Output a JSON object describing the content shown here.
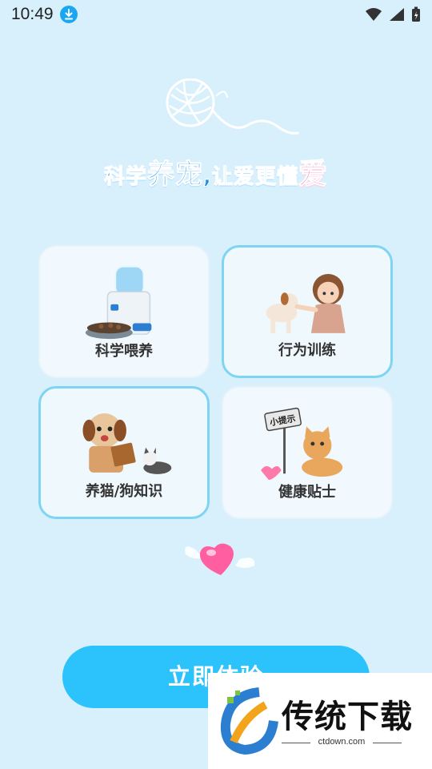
{
  "status_bar": {
    "time": "10:49",
    "icons": [
      "download-icon",
      "wifi-icon",
      "signal-icon",
      "battery-charging-icon"
    ]
  },
  "slogan": {
    "part1": "科学",
    "part2": "养宠",
    "part3": ",让爱更懂",
    "part4": "爱"
  },
  "features": [
    {
      "label": "科学喂养",
      "icon": "water-dispenser-food-bowl-illustration",
      "selected": false
    },
    {
      "label": "行为训练",
      "icon": "girl-training-dog-illustration",
      "selected": true
    },
    {
      "label": "养猫/狗知识",
      "icon": "dog-reading-book-with-cat-illustration",
      "selected": true
    },
    {
      "label": "健康贴士",
      "icon": "cat-holding-tip-sign-illustration",
      "selected": false,
      "sign_text": "小提示"
    }
  ],
  "cta": {
    "label": "立即体验"
  },
  "watermark": {
    "brand": "传统下载",
    "url": "ctdown.com"
  },
  "colors": {
    "background": "#d8f0fb",
    "primary": "#2cc2fb",
    "slogan_blue": "#1f8fe6",
    "slogan_pink": "#ff4f9a"
  }
}
